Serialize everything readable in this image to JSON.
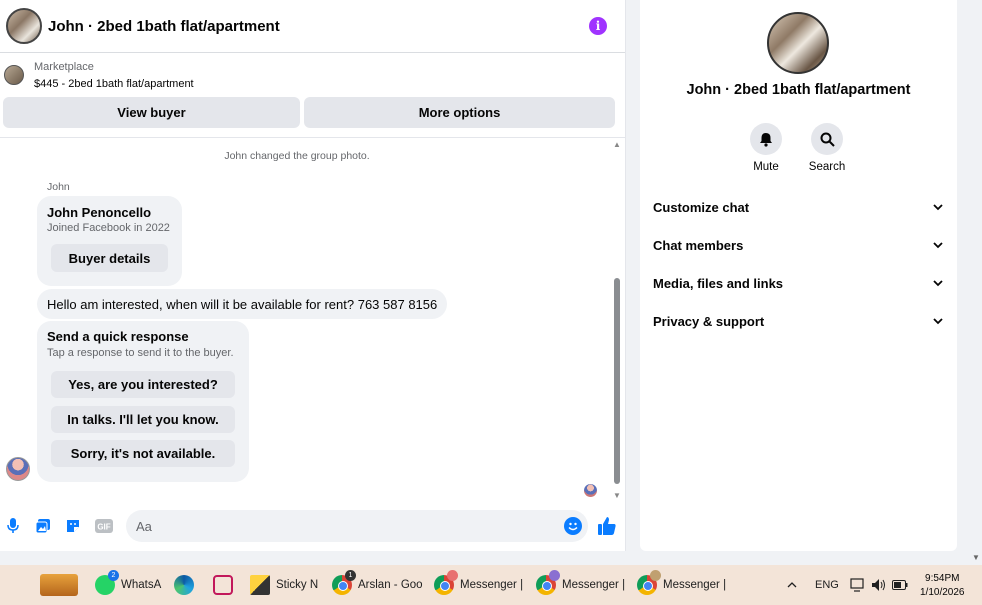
{
  "header": {
    "title": "John · 2bed 1bath flat/apartment"
  },
  "marketplace": {
    "label": "Marketplace",
    "listing": "$445 - 2bed 1bath flat/apartment"
  },
  "actions": {
    "view_buyer": "View buyer",
    "more_options": "More options"
  },
  "messages": {
    "system": "John changed the group photo.",
    "sender": "John",
    "profile_card": {
      "name": "John Penoncello",
      "joined": "Joined Facebook in 2022",
      "button": "Buyer details"
    },
    "text": "Hello am interested, when will it be available for rent? 763 587 8156",
    "quick_response": {
      "title": "Send a quick response",
      "subtitle": "Tap a response to send it to the buyer.",
      "options": [
        "Yes, are you interested?",
        "In talks. I'll let you know.",
        "Sorry, it's not available."
      ]
    }
  },
  "composer": {
    "placeholder": "Aa"
  },
  "info_panel": {
    "title": "John · 2bed 1bath flat/apartment",
    "mute": "Mute",
    "search": "Search",
    "sections": [
      "Customize chat",
      "Chat members",
      "Media, files and links",
      "Privacy & support"
    ]
  },
  "taskbar": {
    "items": [
      "WhatsA",
      "Sticky N",
      "Arslan - Goo",
      "Messenger |",
      "Messenger |",
      "Messenger |"
    ],
    "whatsapp_badge": "2",
    "arslan_badge": "1",
    "language": "ENG",
    "time": "9:54PM",
    "date": "1/10/2026"
  },
  "colors": {
    "accent": "#0a7cff",
    "info": "#a033ff"
  }
}
